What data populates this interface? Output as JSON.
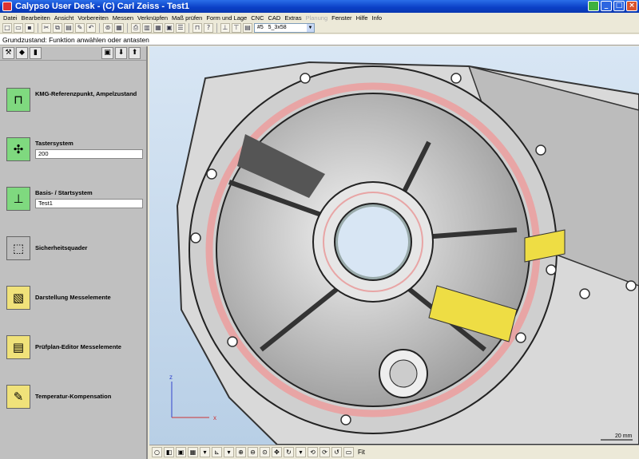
{
  "window": {
    "title": "Calypso User Desk - (C) Carl Zeiss - Test1",
    "min": "_",
    "max": "□",
    "close": "×"
  },
  "menu": [
    "Datei",
    "Bearbeiten",
    "Ansicht",
    "Vorbereiten",
    "Messen",
    "Verknüpfen",
    "Maß prüfen",
    "Form und Lage",
    "CNC",
    "CAD",
    "Extras",
    "Planung",
    "Fenster",
    "Hilfe",
    "Info"
  ],
  "menu_disabled_index": 11,
  "toolbar": {
    "probe_combo_label": "#5",
    "probe_combo_value": "5_3x58"
  },
  "status": {
    "message": "Grundzustand: Funktion anwählen oder antasten"
  },
  "left_items": [
    {
      "label": "KMG-Referenzpunkt, Ampelzustand",
      "value": null,
      "icon": "cmm-reference-icon"
    },
    {
      "label": "Tastersystem",
      "value": "200",
      "icon": "stylus-system-icon"
    },
    {
      "label": "Basis- / Startsystem",
      "value": "Test1",
      "icon": "base-alignment-icon"
    },
    {
      "label": "Sicherheitsquader",
      "value": null,
      "icon": "safety-box-icon"
    },
    {
      "label": "Darstellung Messelemente",
      "value": null,
      "icon": "display-features-icon"
    },
    {
      "label": "Prüfplan-Editor Messelemente",
      "value": null,
      "icon": "plan-editor-icon"
    },
    {
      "label": "Temperatur-Kompensation",
      "value": null,
      "icon": "temperature-icon"
    }
  ],
  "viewport": {
    "scale_label": "20 mm",
    "axis_x": "x",
    "axis_z": "z"
  },
  "bottombar": {
    "fit_label": "Fit"
  },
  "colors": {
    "title_blue": "#0a3fc6",
    "panel_gray": "#c0c0c0",
    "ring_pink": "#e8a5a5",
    "highlight_yellow": "#f0e040"
  }
}
